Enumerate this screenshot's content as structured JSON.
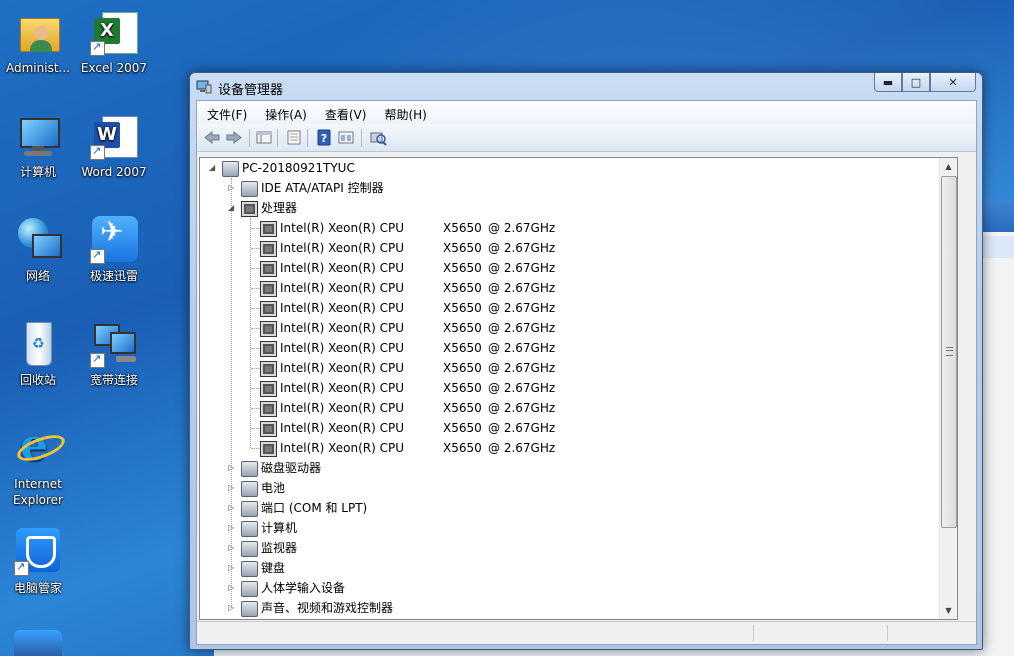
{
  "desktop": {
    "icons": [
      {
        "label": "Administ..."
      },
      {
        "label": "Excel 2007"
      },
      {
        "label": "计算机"
      },
      {
        "label": "Word 2007"
      },
      {
        "label": "网络"
      },
      {
        "label": "极速迅雷"
      },
      {
        "label": "回收站"
      },
      {
        "label": "宽带连接"
      },
      {
        "label": "Internet Explorer"
      },
      {
        "label": "电脑管家"
      }
    ]
  },
  "window": {
    "title": "设备管理器",
    "controls": {
      "minimize": "▬",
      "maximize": "□",
      "close": "✕"
    }
  },
  "menu": [
    "文件(F)",
    "操作(A)",
    "查看(V)",
    "帮助(H)"
  ],
  "toolbar": [
    "back-arrow-icon",
    "forward-arrow-icon",
    "show-hide-tree-icon",
    "properties-icon",
    "help-icon",
    "view-icon",
    "scan-hardware-icon"
  ],
  "tree": {
    "root": "PC-20180921TYUC",
    "ide": "IDE ATA/ATAPI 控制器",
    "processors": {
      "label": "处理器",
      "items": [
        {
          "name": "Intel(R) Xeon(R) CPU",
          "model": "X5650",
          "freq": "@ 2.67GHz"
        },
        {
          "name": "Intel(R) Xeon(R) CPU",
          "model": "X5650",
          "freq": "@ 2.67GHz"
        },
        {
          "name": "Intel(R) Xeon(R) CPU",
          "model": "X5650",
          "freq": "@ 2.67GHz"
        },
        {
          "name": "Intel(R) Xeon(R) CPU",
          "model": "X5650",
          "freq": "@ 2.67GHz"
        },
        {
          "name": "Intel(R) Xeon(R) CPU",
          "model": "X5650",
          "freq": "@ 2.67GHz"
        },
        {
          "name": "Intel(R) Xeon(R) CPU",
          "model": "X5650",
          "freq": "@ 2.67GHz"
        },
        {
          "name": "Intel(R) Xeon(R) CPU",
          "model": "X5650",
          "freq": "@ 2.67GHz"
        },
        {
          "name": "Intel(R) Xeon(R) CPU",
          "model": "X5650",
          "freq": "@ 2.67GHz"
        },
        {
          "name": "Intel(R) Xeon(R) CPU",
          "model": "X5650",
          "freq": "@ 2.67GHz"
        },
        {
          "name": "Intel(R) Xeon(R) CPU",
          "model": "X5650",
          "freq": "@ 2.67GHz"
        },
        {
          "name": "Intel(R) Xeon(R) CPU",
          "model": "X5650",
          "freq": "@ 2.67GHz"
        },
        {
          "name": "Intel(R) Xeon(R) CPU",
          "model": "X5650",
          "freq": "@ 2.67GHz"
        }
      ]
    },
    "categories": [
      "磁盘驱动器",
      "电池",
      "端口 (COM 和 LPT)",
      "计算机",
      "监视器",
      "键盘",
      "人体学输入设备",
      "声音、视频和游戏控制器"
    ]
  },
  "colors": {
    "desktop": "#1a5fb5",
    "window_frame": "#b6cde9",
    "tree_bg": "#ffffff"
  }
}
